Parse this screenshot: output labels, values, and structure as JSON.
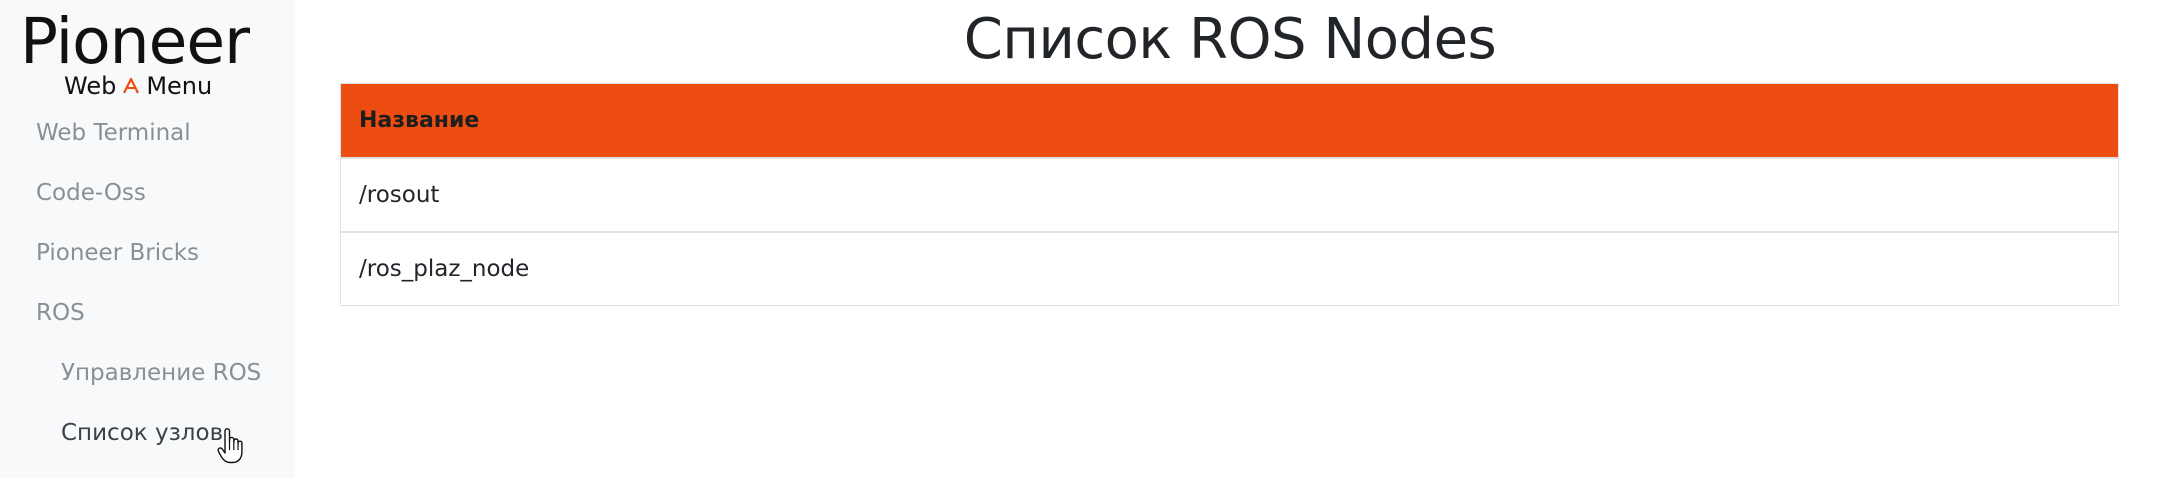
{
  "brand": {
    "name": "Pioneer",
    "tagline_left": "Web",
    "tagline_right": "Menu",
    "accent_color": "#ed4d11"
  },
  "sidebar": {
    "items": [
      {
        "label": "Web Terminal"
      },
      {
        "label": "Code-Oss"
      },
      {
        "label": "Pioneer Bricks"
      },
      {
        "label": "ROS"
      },
      {
        "label": "Управление ROS"
      },
      {
        "label": "Список узлов"
      }
    ]
  },
  "main": {
    "title": "Список ROS Nodes",
    "table": {
      "headers": [
        "Название"
      ],
      "rows": [
        "/rosout",
        "/ros_plaz_node"
      ],
      "header_color": "#ed4d11"
    }
  },
  "icons": {
    "logo_mark": "triangle-mark-icon",
    "cursor": "hand-pointer-icon"
  }
}
